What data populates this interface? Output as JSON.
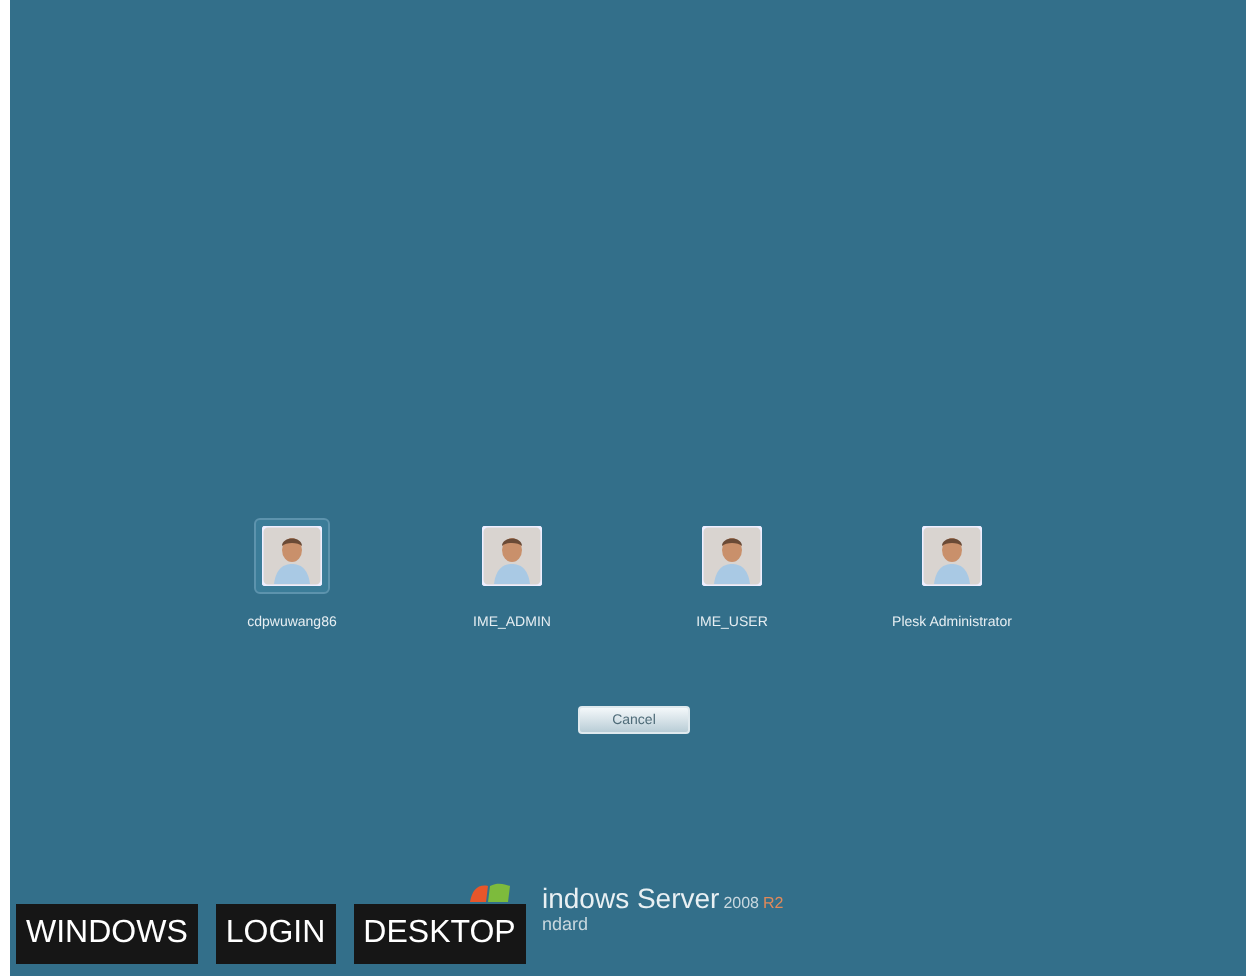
{
  "users": [
    {
      "name": "cdpwuwang86",
      "selected": true
    },
    {
      "name": "IME_ADMIN",
      "selected": false
    },
    {
      "name": "IME_USER",
      "selected": false
    },
    {
      "name": "Plesk Administrator",
      "selected": false
    }
  ],
  "cancel_button": "Cancel",
  "logo": {
    "brand": "indows Server",
    "version": "2008",
    "release": "R2",
    "edition": "ndard"
  },
  "tags": [
    "WINDOWS",
    "LOGIN",
    "DESKTOP"
  ]
}
